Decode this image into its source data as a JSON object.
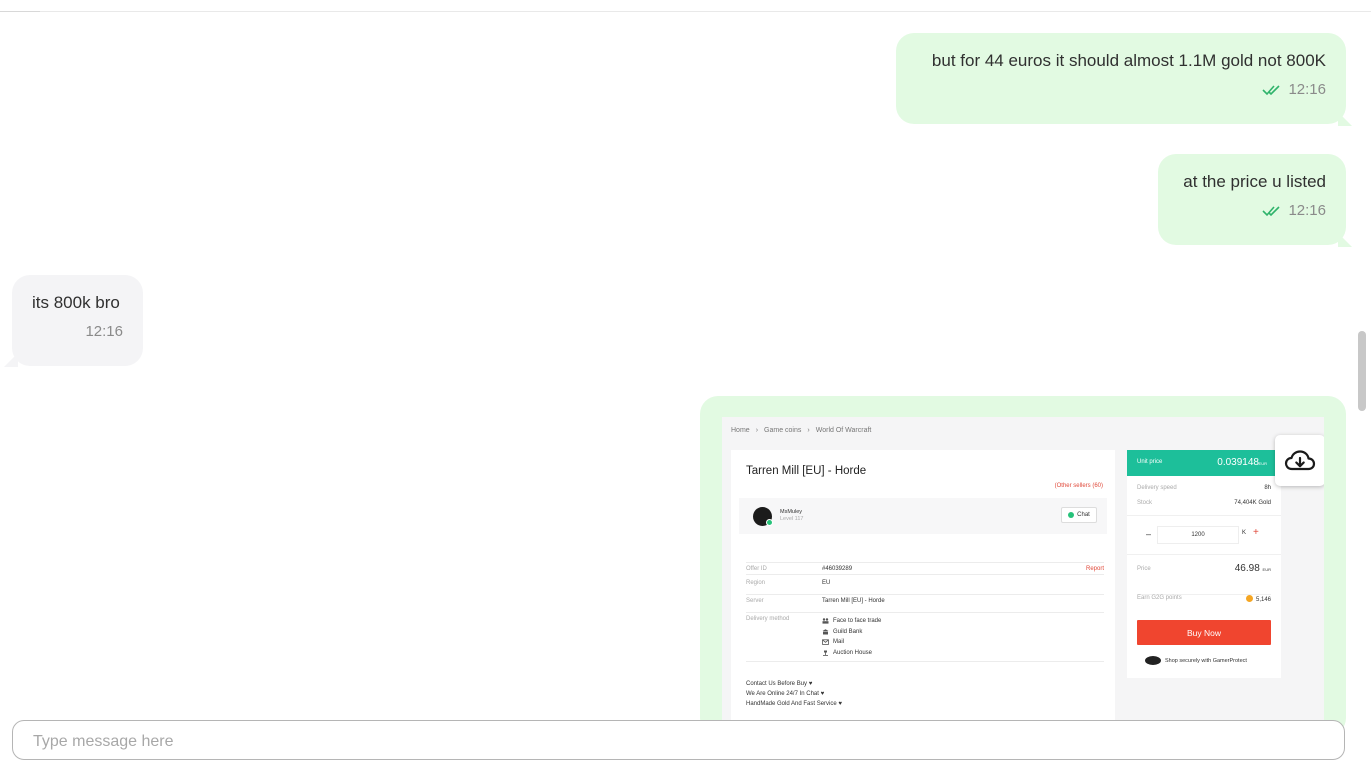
{
  "messages": [
    {
      "direction": "outgoing",
      "text": "but for 44 euros it should almost 1.1M gold not 800K",
      "time": "12:16",
      "status": "read"
    },
    {
      "direction": "outgoing",
      "text": "at the price u listed",
      "time": "12:16",
      "status": "read"
    },
    {
      "direction": "incoming",
      "text": "its 800k bro",
      "time": "12:16"
    }
  ],
  "image_message": {
    "breadcrumb": [
      "Home",
      "Game coins",
      "World Of Warcraft"
    ],
    "breadcrumb_sep": "›",
    "title": "Tarren Mill [EU] - Horde",
    "other_sellers": "(Other sellers (60)",
    "seller": {
      "name": "MsMuley",
      "level": "Level 117",
      "chat_label": "Chat"
    },
    "details": {
      "offer_id_label": "Offer ID",
      "offer_id": "#46039289",
      "report": "Report",
      "region_label": "Region",
      "region": "EU",
      "server_label": "Server",
      "server": "Tarren Mill [EU] - Horde",
      "delivery_label": "Delivery method",
      "delivery_methods": [
        "Face to face trade",
        "Guild Bank",
        "Mail",
        "Auction House"
      ]
    },
    "notes": [
      "Contact Us Before Buy ♥",
      "We Are Online 24/7 In Chat ♥",
      "HandMade Gold And Fast Service ♥"
    ],
    "purchase": {
      "unit_price_label": "Unit price",
      "unit_price": "0.039148",
      "currency": "EUR",
      "delivery_speed_label": "Delivery speed",
      "delivery_speed": "8h",
      "stock_label": "Stock",
      "stock": "74,404K Gold",
      "quantity": "1200",
      "quantity_unit": "K",
      "price_label": "Price",
      "price": "46.98",
      "points_label": "Earn G2G points",
      "points": "5,146",
      "buy_label": "Buy Now",
      "protect_text": "Shop securely with GamerProtect"
    },
    "download_icon": "cloud-download-icon"
  },
  "composer": {
    "placeholder": "Type message here"
  },
  "colors": {
    "outgoing_bubble": "#e2fae2",
    "incoming_bubble": "#f4f4f6",
    "read_ticks": "#2fb36b",
    "buy_button": "#f0452f",
    "unit_price_bar": "#1dbf9a"
  }
}
